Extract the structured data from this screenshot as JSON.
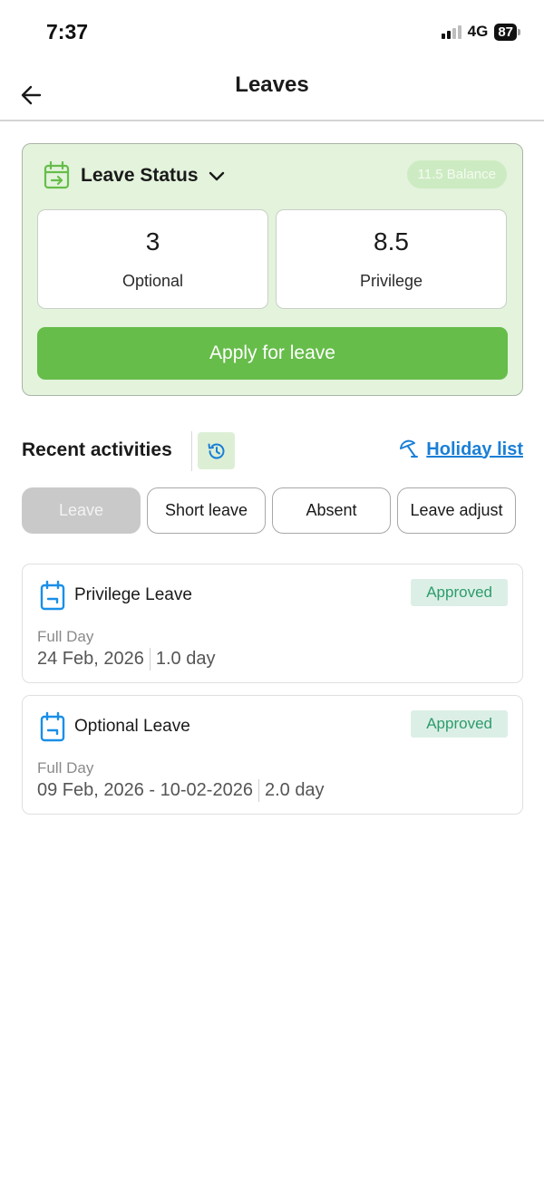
{
  "status_bar": {
    "time": "7:37",
    "network": "4G",
    "battery": "87"
  },
  "header": {
    "title": "Leaves",
    "back_icon": "arrow-left-icon"
  },
  "leave_status": {
    "icon": "calendar-transfer-icon",
    "title": "Leave Status",
    "dropdown_icon": "chevron-down-icon",
    "balance": "11.5 Balance",
    "counters": [
      {
        "value": "3",
        "label": "Optional"
      },
      {
        "value": "8.5",
        "label": "Privilege"
      }
    ],
    "apply_label": "Apply for leave"
  },
  "recent": {
    "title": "Recent activities",
    "history_icon": "history-icon",
    "holiday_icon": "umbrella-icon",
    "holiday_link": "Holiday list"
  },
  "tabs": [
    {
      "label": "Leave",
      "active": true
    },
    {
      "label": "Short leave",
      "active": false
    },
    {
      "label": "Absent",
      "active": false
    },
    {
      "label": "Leave adjust",
      "active": false
    }
  ],
  "activities": [
    {
      "icon": "calendar-icon",
      "title": "Privilege Leave",
      "status": "Approved",
      "type": "Full Day",
      "dates": "24 Feb, 2026",
      "duration": "1.0 day"
    },
    {
      "icon": "calendar-icon",
      "title": "Optional Leave",
      "status": "Approved",
      "type": "Full Day",
      "dates": "09 Feb, 2026 - 10-02-2026",
      "duration": "2.0 day"
    }
  ],
  "colors": {
    "accent_green": "#66bd4a",
    "card_green": "#e3f3dc",
    "link_blue": "#1a7fd6",
    "approved_text": "#2c9c6c",
    "calendar_blue": "#1a8fe8"
  }
}
